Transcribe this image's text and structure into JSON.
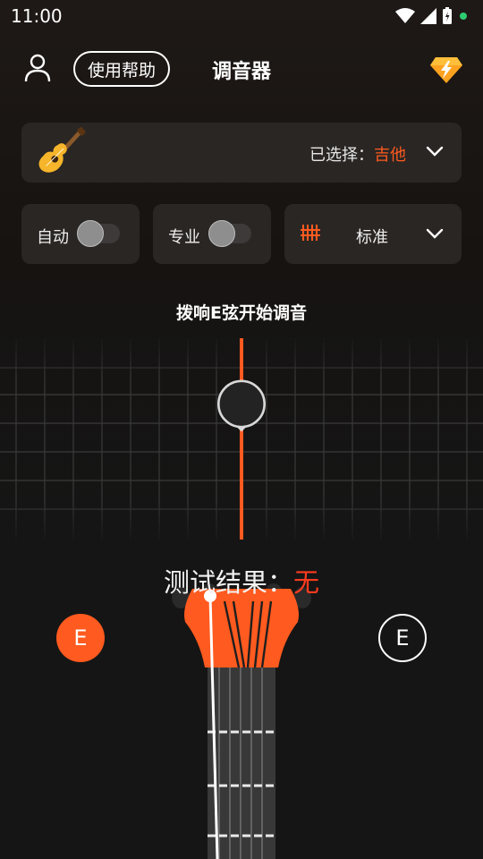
{
  "status_bar": {
    "time": "11:00"
  },
  "header": {
    "help_label": "使用帮助",
    "title": "调音器"
  },
  "instrument": {
    "label": "已选择：",
    "value": "吉他"
  },
  "controls": {
    "auto_label": "自动",
    "auto_on": false,
    "pro_label": "专业",
    "pro_on": false,
    "tuning_label": "标准"
  },
  "tuner": {
    "prompt": "拨响E弦开始调音",
    "result_label": "测试结果：",
    "result_value": "无",
    "string_left": "E",
    "string_right": "E"
  },
  "colors": {
    "accent": "#ff5a1f",
    "card": "#2a2624",
    "background": "#151515"
  }
}
